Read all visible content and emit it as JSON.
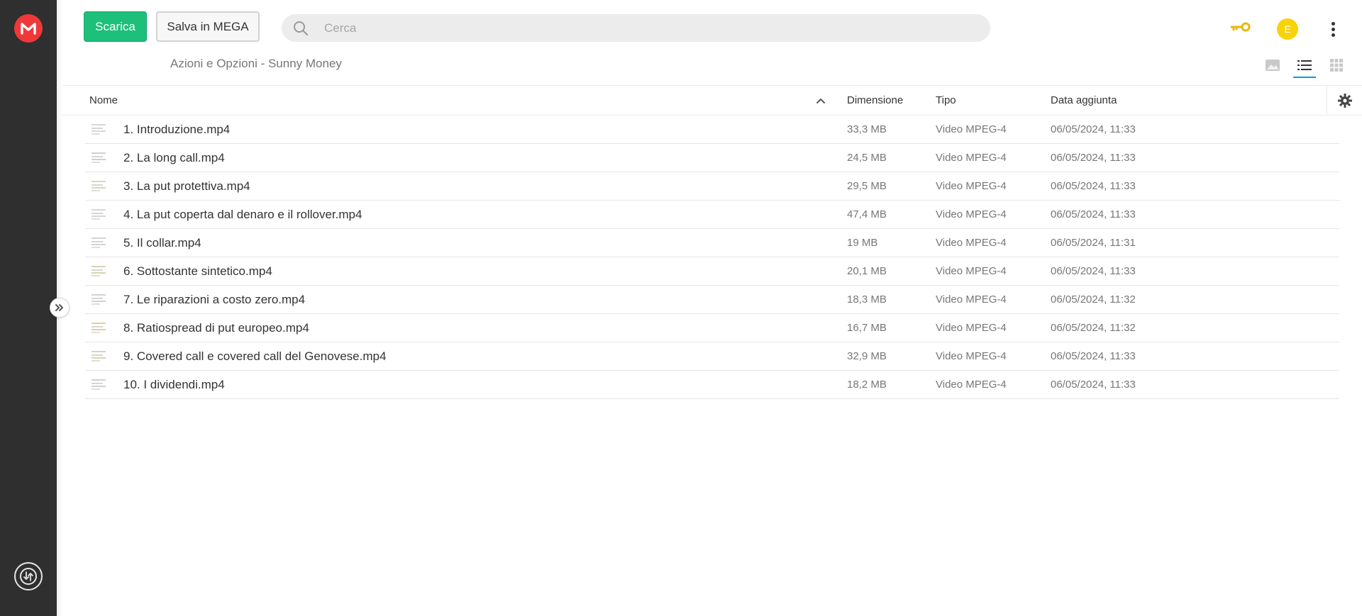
{
  "app": {
    "logo_icon": "mega-logo-icon",
    "brand_color": "#f0373a",
    "accent_color": "#1dbf7b"
  },
  "toolbar": {
    "download_label": "Scarica",
    "save_label": "Salva in MEGA",
    "search_placeholder": "Cerca",
    "avatar_letter": "E",
    "avatar_color": "#f7d30a"
  },
  "breadcrumb": {
    "folder": "Azioni e Opzioni - Sunny Money"
  },
  "view_modes": {
    "options": [
      "media",
      "list",
      "grid"
    ],
    "active": "list"
  },
  "table": {
    "columns": {
      "name": "Nome",
      "size": "Dimensione",
      "type": "Tipo",
      "date": "Data aggiunta"
    },
    "sort": "name-ascending",
    "rows": [
      {
        "name": "1. Introduzione.mp4",
        "size": "33,3 MB",
        "type": "Video MPEG-4",
        "date": "06/05/2024, 11:33"
      },
      {
        "name": "2. La long call.mp4",
        "size": "24,5 MB",
        "type": "Video MPEG-4",
        "date": "06/05/2024, 11:33"
      },
      {
        "name": "3. La put protettiva.mp4",
        "size": "29,5 MB",
        "type": "Video MPEG-4",
        "date": "06/05/2024, 11:33"
      },
      {
        "name": "4. La put coperta dal denaro e il rollover.mp4",
        "size": "47,4 MB",
        "type": "Video MPEG-4",
        "date": "06/05/2024, 11:33"
      },
      {
        "name": "5. Il collar.mp4",
        "size": "19 MB",
        "type": "Video MPEG-4",
        "date": "06/05/2024, 11:31"
      },
      {
        "name": "6. Sottostante sintetico.mp4",
        "size": "20,1 MB",
        "type": "Video MPEG-4",
        "date": "06/05/2024, 11:33"
      },
      {
        "name": "7. Le riparazioni a costo zero.mp4",
        "size": "18,3 MB",
        "type": "Video MPEG-4",
        "date": "06/05/2024, 11:32"
      },
      {
        "name": "8. Ratiospread di put europeo.mp4",
        "size": "16,7 MB",
        "type": "Video MPEG-4",
        "date": "06/05/2024, 11:32"
      },
      {
        "name": "9. Covered call e covered call del Genovese.mp4",
        "size": "32,9 MB",
        "type": "Video MPEG-4",
        "date": "06/05/2024, 11:33"
      },
      {
        "name": "10. I dividendi.mp4",
        "size": "18,2 MB",
        "type": "Video MPEG-4",
        "date": "06/05/2024, 11:33"
      }
    ]
  }
}
